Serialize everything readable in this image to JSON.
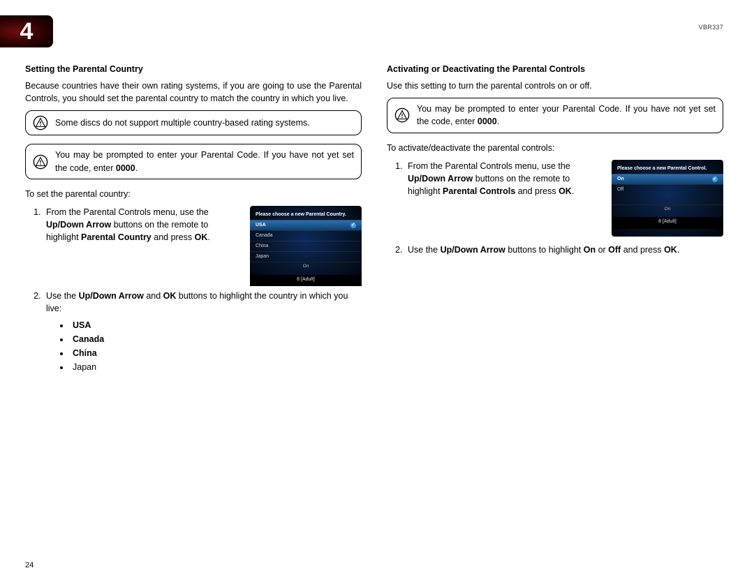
{
  "chapter_number": "4",
  "model": "VBR337",
  "page_number": "24",
  "left": {
    "h": "Setting the Parental Country",
    "intro": "Because countries have their own rating systems, if you are going to use the Parental Controls, you should set the parental country to match the country in which you live.",
    "callout1": "Some discs do not support multiple country-based rating systems.",
    "callout2_a": "You may be prompted to enter your Parental Code. If you have not yet set the code, enter ",
    "callout2_b": "0000",
    "callout2_c": ".",
    "lead": "To set the parental country:",
    "step1_a": "From the Parental Controls menu, use the ",
    "step1_b": "Up/Down Arrow",
    "step1_c": " buttons on the remote to highlight ",
    "step1_d": "Parental Country",
    "step1_e": " and press ",
    "step1_f": "OK",
    "step1_g": ".",
    "step2_a": "Use the ",
    "step2_b": "Up/Down Arrow",
    "step2_c": " and ",
    "step2_d": "OK",
    "step2_e": " buttons to highlight the country in which you live:",
    "opts": {
      "usa": "USA",
      "canada": "Canada",
      "china": "China",
      "japan": "Japan"
    },
    "ss": {
      "title": "Please choose a new Parental Country.",
      "r1": "USA",
      "r2": "Canada",
      "r3": "China",
      "r4": "Japan",
      "foot_top": "On",
      "foot": "8 [Adult]"
    }
  },
  "right": {
    "h": "Activating or Deactivating the Parental Controls",
    "intro": "Use this setting to turn the parental controls on or off.",
    "callout_a": "You may be prompted to enter your Parental Code. If you have not yet set the code, enter ",
    "callout_b": "0000",
    "callout_c": ".",
    "lead": "To activate/deactivate the parental controls:",
    "step1_a": "From the Parental Controls menu, use the ",
    "step1_b": "Up/Down Arrow",
    "step1_c": " buttons on the remote to highlight ",
    "step1_d": "Parental Controls",
    "step1_e": " and press ",
    "step1_f": "OK",
    "step1_g": ".",
    "step2_a": "Use the ",
    "step2_b": "Up/Down Arrow",
    "step2_c": " buttons to highlight ",
    "step2_d": "On",
    "step2_e": " or ",
    "step2_f": "Off",
    "step2_g": " and press ",
    "step2_h": "OK",
    "step2_i": ".",
    "ss": {
      "title": "Please choose a new Parental Control.",
      "r1": "On",
      "r2": "Off",
      "foot_top": "On",
      "foot": "8 [Adult]"
    }
  }
}
